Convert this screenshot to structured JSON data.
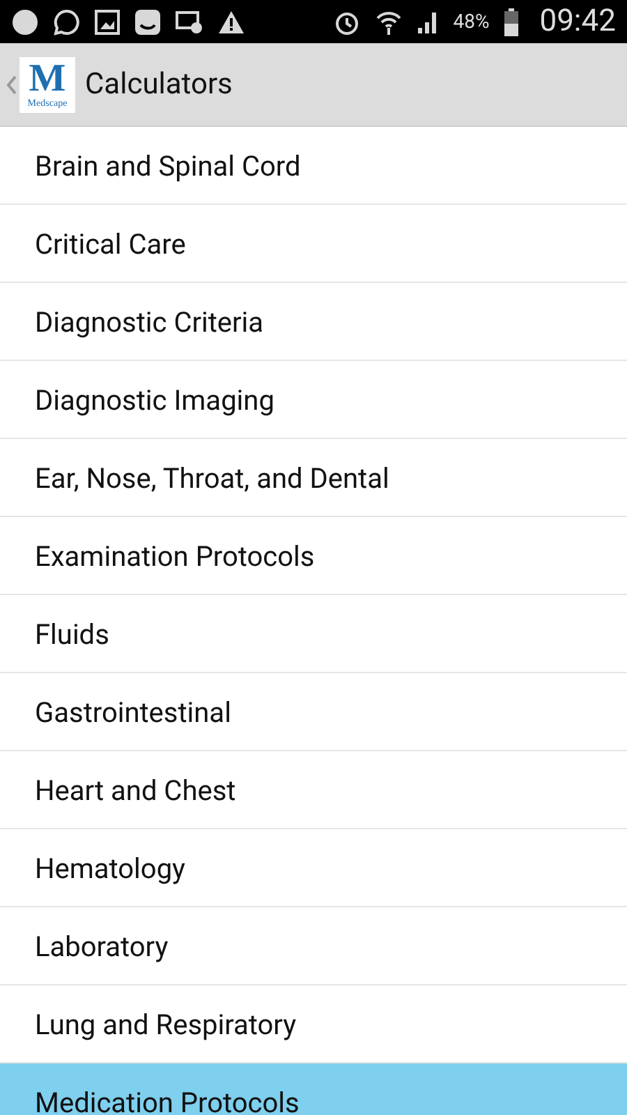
{
  "status_bar": {
    "battery_text": "48%",
    "time": "09:42"
  },
  "header": {
    "logo_letter": "M",
    "logo_word": "Medscape",
    "title": "Calculators"
  },
  "items": [
    {
      "label": "Brain and Spinal Cord",
      "selected": false
    },
    {
      "label": "Critical Care",
      "selected": false
    },
    {
      "label": "Diagnostic Criteria",
      "selected": false
    },
    {
      "label": "Diagnostic Imaging",
      "selected": false
    },
    {
      "label": "Ear, Nose, Throat, and Dental",
      "selected": false
    },
    {
      "label": "Examination Protocols",
      "selected": false
    },
    {
      "label": "Fluids",
      "selected": false
    },
    {
      "label": "Gastrointestinal",
      "selected": false
    },
    {
      "label": "Heart and Chest",
      "selected": false
    },
    {
      "label": "Hematology",
      "selected": false
    },
    {
      "label": "Laboratory",
      "selected": false
    },
    {
      "label": "Lung and Respiratory",
      "selected": false
    },
    {
      "label": "Medication Protocols",
      "selected": true
    }
  ]
}
